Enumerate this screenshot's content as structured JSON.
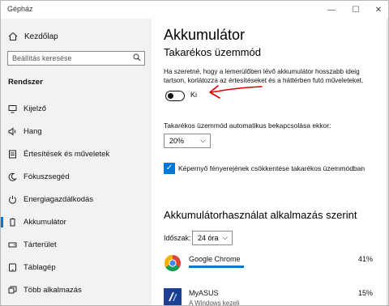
{
  "window": {
    "title": "Gépház",
    "minimize": "—",
    "maximize": "☐",
    "close": "✕"
  },
  "sidebar": {
    "home": "Kezdőlap",
    "search_placeholder": "Beállítás keresése",
    "section": "Rendszer",
    "items": [
      {
        "label": "Kijelző",
        "icon": "display-icon"
      },
      {
        "label": "Hang",
        "icon": "speaker-icon"
      },
      {
        "label": "Értesítések és műveletek",
        "icon": "notification-icon"
      },
      {
        "label": "Fókuszsegéd",
        "icon": "moon-icon"
      },
      {
        "label": "Energiagazdálkodás",
        "icon": "power-icon"
      },
      {
        "label": "Akkumulátor",
        "icon": "battery-icon",
        "selected": true
      },
      {
        "label": "Tárterület",
        "icon": "storage-icon"
      },
      {
        "label": "Táblagép",
        "icon": "tablet-icon"
      },
      {
        "label": "Több alkalmazás",
        "icon": "multitask-icon"
      }
    ]
  },
  "main": {
    "title": "Akkumulátor",
    "saver_heading": "Takarékos üzemmód",
    "saver_desc": "Ha szeretné, hogy a lemerülőben lévő akkumulátor hosszabb ideig tartson, korlátozza az értesítéseket és a háttérben futó műveleteket.",
    "toggle_label": "Ki",
    "toggle_on": false,
    "auto_label": "Takarékos üzemmód automatikus bekapcsolása ekkor:",
    "auto_value": "20%",
    "brightness_label": "Képernyő fényerejének csökkentése takarékos üzemmódban",
    "brightness_checked": true,
    "usage_heading": "Akkumulátorhasználat alkalmazás szerint",
    "period_label": "Időszak:",
    "period_value": "24 óra",
    "apps": [
      {
        "name": "Google Chrome",
        "percent": "41%",
        "usage": 0.41,
        "sub": ""
      },
      {
        "name": "MyASUS",
        "percent": "15%",
        "usage": 0.15,
        "sub": "A Windows kezeli"
      }
    ]
  },
  "colors": {
    "accent": "#0078d7",
    "annotation": "#e00000"
  }
}
